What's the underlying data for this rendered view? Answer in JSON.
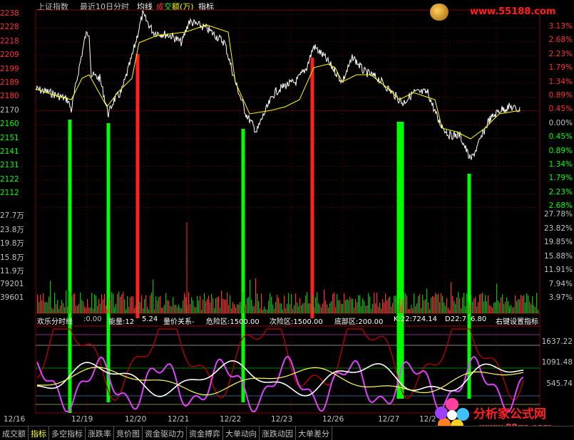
{
  "title_bar": {
    "index_name": "上证指数",
    "period_label": "最近10日分时",
    "avg_line_label": "均线",
    "cheng_label": "成",
    "jiao_label": "交",
    "volume_label": "额(万)",
    "indicator_label": "指标"
  },
  "price_axis_left": [
    "2238",
    "2228",
    "2218",
    "2209",
    "2199",
    "2189",
    "2180",
    "2170",
    "2160",
    "2151",
    "2141",
    "2131",
    "2122",
    "2112"
  ],
  "price_axis_right": [
    "3.13%",
    "2.68%",
    "2.23%",
    "1.79%",
    "1.34%",
    "0.89%",
    "0.45%",
    "0.00%",
    "0.45%",
    "0.89%",
    "1.34%",
    "1.79%",
    "2.23%",
    "2.68%"
  ],
  "volume_axis_left": [
    "27.7万",
    "23.8万",
    "19.8万",
    "15.8万",
    "11.9万",
    "79201",
    "39601"
  ],
  "volume_axis_right": [
    "27.78%",
    "23.82%",
    "19.85%",
    "15.88%",
    "11.91%",
    "7.94%",
    "3.97%"
  ],
  "indicator_header": {
    "name": "欢乐分时线",
    "v0": ":0.00",
    "energy": "能量:12",
    "energy_val": "5.24",
    "vp_label": "量价关系-",
    "danger": "危险区:1500.00",
    "sub_danger": "次险区:1500.00",
    "bottom": "底部区:200.00",
    "k": "K:22:724.14",
    "d": "D22:7",
    "d2": "6.80",
    "tail": "右键设置指标"
  },
  "indicator_axis": [
    "1637.22",
    "1091.48",
    "545.74"
  ],
  "dates": [
    "12/16",
    "12/19",
    "12/20",
    "12/21",
    "12/22",
    "12/23",
    "12/26",
    "12/27",
    "12/2"
  ],
  "tabs": [
    "成交额",
    "指标",
    "多空指标",
    "涨跌率",
    "竞价图",
    "资金驱动力",
    "资金搏弈",
    "大单动向",
    "涨跌动因",
    "大单差分"
  ],
  "active_tab_index": 1,
  "watermark_top": "www.55188.com",
  "watermark_bottom_title": "分析家公式网",
  "watermark_bottom_url": "www.88gs.com",
  "colors": {
    "up": "#ff3030",
    "down": "#00ff00",
    "price_line": "#ffffff",
    "avg_line": "#ffff00",
    "grid": "#800000",
    "axis_up": "#ff3030",
    "axis_down": "#00ff00",
    "indicator_red": "#c00000",
    "indicator_magenta": "#e040ff",
    "indicator_white": "#ffffff",
    "indicator_yellow": "#ffff60"
  }
}
